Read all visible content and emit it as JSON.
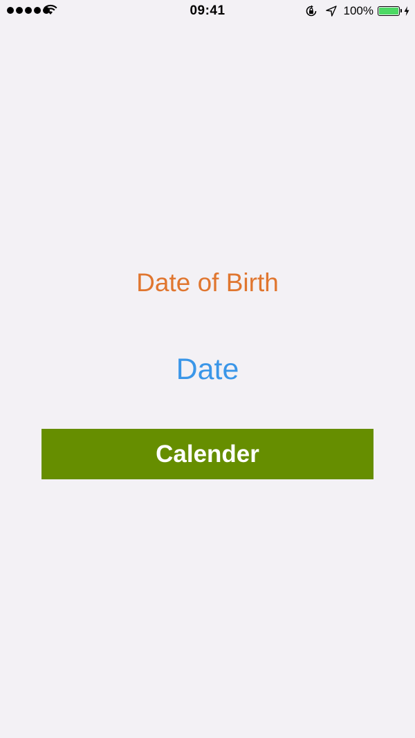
{
  "status_bar": {
    "signal_bars": 5,
    "time": "09:41",
    "battery_percent": "100%",
    "battery_level": 1.0,
    "battery_color": "#4cd964",
    "icons": [
      "signal-dots-icon",
      "wifi-icon",
      "orientation-lock-icon",
      "location-arrow-icon",
      "battery-icon",
      "charging-bolt-icon"
    ]
  },
  "main": {
    "title": "Date of Birth",
    "date_value": "Date",
    "calendar_button_label": "Calender"
  },
  "colors": {
    "background": "#f3f1f5",
    "title": "#e0762f",
    "date": "#3a96e8",
    "button": "#668e00",
    "button_text": "#ffffff"
  }
}
